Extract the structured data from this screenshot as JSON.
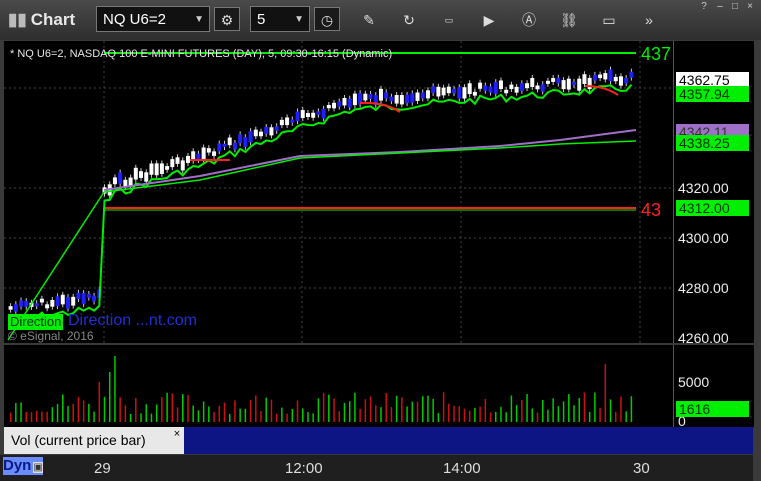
{
  "window": {
    "title": "Chart"
  },
  "toolbar": {
    "symbol": "NQ U6=2",
    "interval": "5"
  },
  "chart": {
    "legend": "* NQ U6=2, NASDAQ 100 E-MINI FUTURES (DAY), 5, 09:30-16:15 (Dynamic)",
    "watermark": "Direction ...nt.com",
    "direction_label": "Direction",
    "copyright": "© eSignal, 2016",
    "edge_labels": {
      "top": "437",
      "mid": "43"
    },
    "price_ticks": [
      "4320.00",
      "4300.00",
      "4280.00",
      "4260.00"
    ],
    "price_boxes": [
      {
        "label": "4362.75",
        "bg": "#ffffff",
        "fg": "#000000"
      },
      {
        "label": "4357.94",
        "bg": "#00ee00",
        "fg": "#003300"
      },
      {
        "label": "4342.11",
        "bg": "#a070c8",
        "fg": "#333333"
      },
      {
        "label": "4338.25",
        "bg": "#00ee00",
        "fg": "#003300"
      },
      {
        "label": "4312.00",
        "bg": "#00ee00",
        "fg": "#003300"
      }
    ]
  },
  "volume": {
    "tab_label": "Vol (current price bar)",
    "close": "×",
    "ticks": [
      "5000",
      "0"
    ],
    "last_box": "1616"
  },
  "time_axis": {
    "mode": "Dyn",
    "labels": [
      "29",
      "12:00",
      "14:00",
      "30"
    ]
  },
  "colors": {
    "up": "#ffffff",
    "down": "#2020ff",
    "ma_green": "#00ee00",
    "ma_red": "#ff2020",
    "ma_purple": "#a070c8"
  }
}
